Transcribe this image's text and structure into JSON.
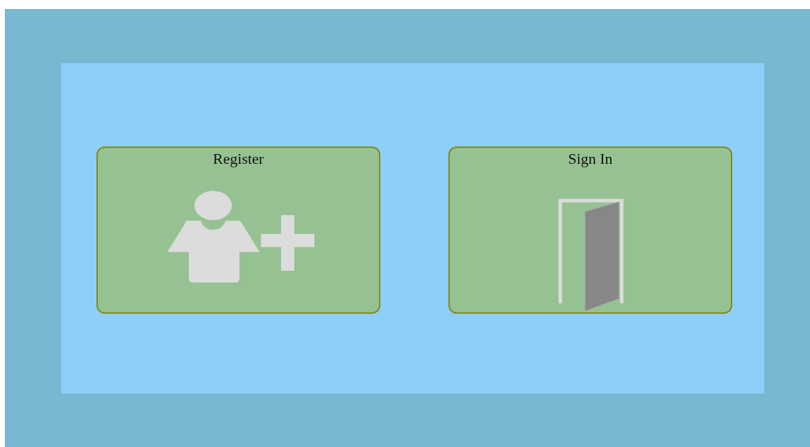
{
  "cards": [
    {
      "kind": "register",
      "label": "Register"
    },
    {
      "kind": "sign-in",
      "label": "Sign In"
    }
  ]
}
